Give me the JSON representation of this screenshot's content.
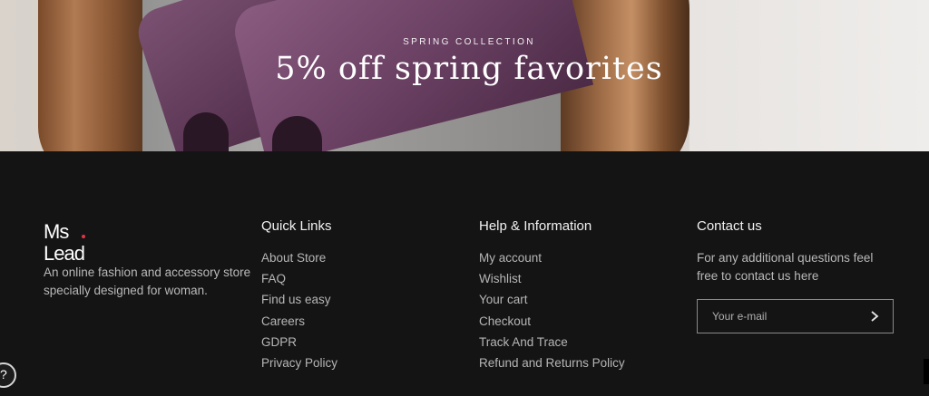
{
  "hero": {
    "kicker": "SPRING COLLECTION",
    "title": "5% off spring favorites"
  },
  "brand": {
    "logo_text": "Ms. Lead",
    "tagline": "An online fashion and accessory store specially designed for woman."
  },
  "quick_links": {
    "title": "Quick Links",
    "items": [
      "About Store",
      "FAQ",
      "Find us easy",
      "Careers",
      "GDPR",
      "Privacy Policy"
    ]
  },
  "help": {
    "title": "Help & Information",
    "items": [
      "My account",
      "Wishlist",
      "Your cart",
      "Checkout",
      "Track And Trace",
      "Refund and Returns Policy"
    ]
  },
  "contact": {
    "title": "Contact us",
    "text": "For any additional questions feel free to contact us here",
    "email_placeholder": "Your e-mail",
    "submit_icon": "chevron-right-icon"
  },
  "widgets": {
    "help_icon": "question-circle-icon"
  },
  "colors": {
    "background": "#141414",
    "heading": "#f2f2f2",
    "text": "#b6b6b6"
  }
}
